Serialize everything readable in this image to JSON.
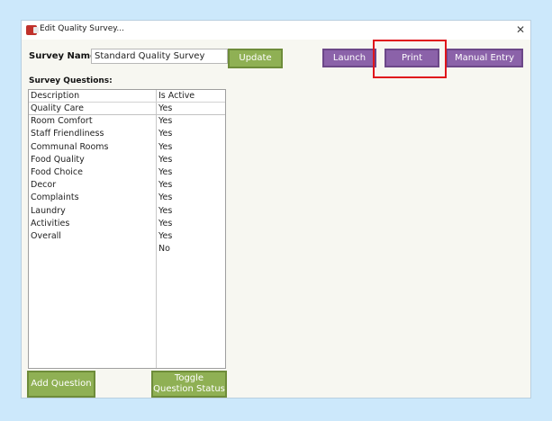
{
  "window": {
    "title": "Edit Quality Survey...",
    "close_glyph": "✕"
  },
  "survey": {
    "name_label": "Survey Name:",
    "name_value": "Standard Quality Survey",
    "update_label": "Update"
  },
  "toolbar": {
    "launch_label": "Launch",
    "print_label": "Print",
    "manual_entry_label": "Manual Entry"
  },
  "questions": {
    "section_label": "Survey Questions:",
    "columns": [
      "Description",
      "Is Active"
    ],
    "rows": [
      {
        "description": "Quality Care",
        "active": "Yes"
      },
      {
        "description": "Room Comfort",
        "active": "Yes"
      },
      {
        "description": "Staff Friendliness",
        "active": "Yes"
      },
      {
        "description": "Communal Rooms",
        "active": "Yes"
      },
      {
        "description": "Food Quality",
        "active": "Yes"
      },
      {
        "description": "Food Choice",
        "active": "Yes"
      },
      {
        "description": "Decor",
        "active": "Yes"
      },
      {
        "description": "Complaints",
        "active": "Yes"
      },
      {
        "description": "Laundry",
        "active": "Yes"
      },
      {
        "description": "Activities",
        "active": "Yes"
      },
      {
        "description": "Overall",
        "active": "Yes"
      },
      {
        "description": "",
        "active": "No"
      }
    ],
    "add_label": "Add Question",
    "toggle_label": "Toggle Question Status"
  },
  "colors": {
    "background": "#cce8fb",
    "green_button": "#8fb054",
    "purple_button": "#8b62a9",
    "highlight": "#e0151b"
  },
  "icons": {
    "app": "access-app-icon",
    "close": "close-icon"
  }
}
